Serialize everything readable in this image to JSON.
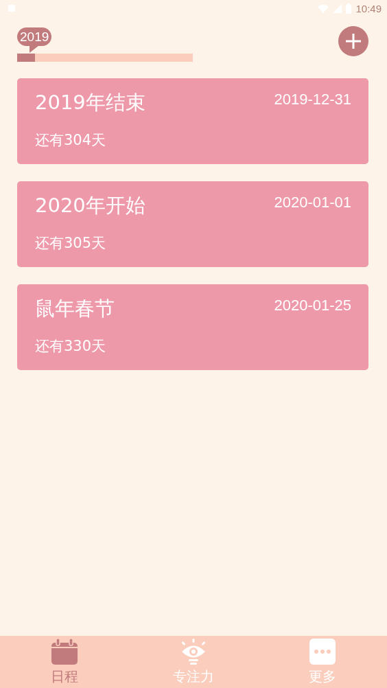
{
  "status_bar": {
    "time": "10:49"
  },
  "year_progress": {
    "year": "2019",
    "level": 0.1
  },
  "events": [
    {
      "title": "2019年结束",
      "date": "2019-12-31",
      "countdown": "还有304天"
    },
    {
      "title": "2020年开始",
      "date": "2020-01-01",
      "countdown": "还有305天"
    },
    {
      "title": "鼠年春节",
      "date": "2020-01-25",
      "countdown": "还有330天"
    }
  ],
  "tabs": [
    {
      "label": "日程",
      "kind": "calendar",
      "selected": true
    },
    {
      "label": "专注力",
      "kind": "eye",
      "selected": false
    },
    {
      "label": "更多",
      "kind": "more",
      "selected": false
    }
  ]
}
